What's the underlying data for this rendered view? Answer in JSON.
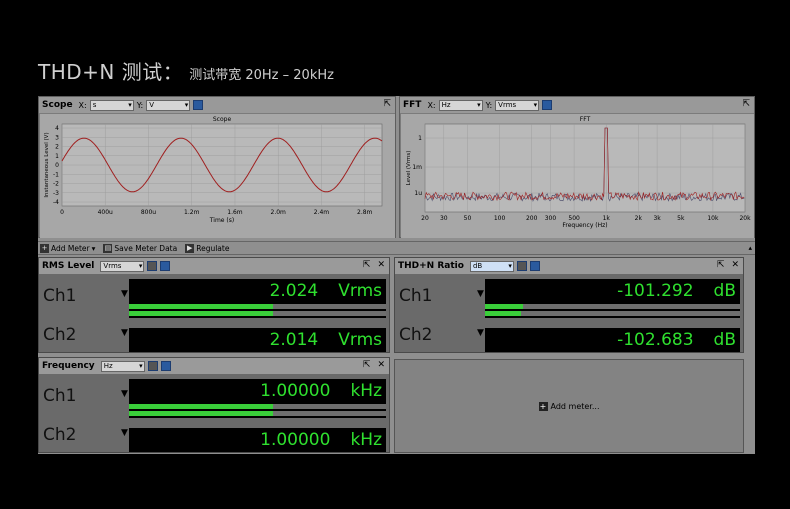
{
  "title": {
    "main": "THD+N 测试：",
    "sub": "测试带宽 20Hz – 20kHz"
  },
  "scope": {
    "label": "Scope",
    "x_label": "X:",
    "x_unit": "s",
    "y_label": "Y:",
    "y_unit": "V",
    "plot_title": "Scope",
    "ylabel": "Instantaneous Level (V)",
    "xlabel": "Time (s)",
    "yticks": [
      "4",
      "3",
      "2",
      "1",
      "0",
      "-1",
      "-2",
      "-3",
      "-4"
    ],
    "xticks": [
      "0",
      "400u",
      "800u",
      "1.2m",
      "1.6m",
      "2.0m",
      "2.4m",
      "2.8m"
    ]
  },
  "fft": {
    "label": "FFT",
    "x_label": "X:",
    "x_unit": "Hz",
    "y_label": "Y:",
    "y_unit": "Vrms",
    "plot_title": "FFT",
    "ylabel": "Level (Vrms)",
    "xlabel": "Frequency (Hz)",
    "yticks": [
      "1",
      "1m",
      "1u"
    ],
    "xticks": [
      "20",
      "30",
      "50",
      "100",
      "200",
      "300",
      "500",
      "1k",
      "2k",
      "3k",
      "5k",
      "10k",
      "20k"
    ]
  },
  "toolbar": {
    "add_meter": "Add Meter",
    "save": "Save Meter Data",
    "regulate": "Regulate"
  },
  "rms": {
    "label": "RMS Level",
    "unit_select": "Vrms",
    "ch1": "Ch1",
    "ch2": "Ch2",
    "v1": "2.024",
    "v2": "2.014",
    "unit": "Vrms",
    "level1": 0.56,
    "level2": 0.56
  },
  "thdn": {
    "label": "THD+N Ratio",
    "unit_select": "dB",
    "ch1": "Ch1",
    "ch2": "Ch2",
    "v1": "-101.292",
    "v2": "-102.683",
    "unit": "dB",
    "level1": 0.15,
    "level2": 0.14
  },
  "freq": {
    "label": "Frequency",
    "unit_select": "Hz",
    "ch1": "Ch1",
    "ch2": "Ch2",
    "v1": "1.00000",
    "v2": "1.00000",
    "unit": "kHz",
    "level1": 0.56,
    "level2": 0.56
  },
  "add_meter_panel": {
    "label": "Add meter..."
  },
  "colors": {
    "trace": "#a02020",
    "meter_text": "#2fe02f",
    "bar": "#3acf3a"
  }
}
